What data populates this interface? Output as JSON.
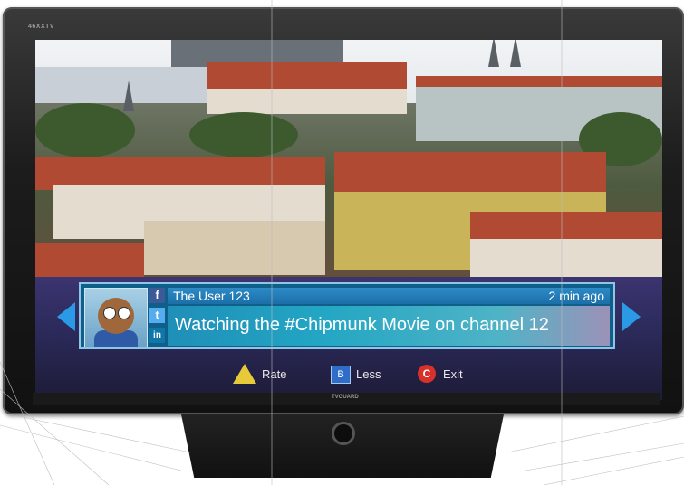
{
  "tv": {
    "brand_top": "46XXTV",
    "brand_bottom": "TVGUARD"
  },
  "post": {
    "user": "The User 123",
    "time_ago": "2 min ago",
    "message": "Watching the #Chipmunk Movie on channel 12"
  },
  "social_icons": [
    "facebook-icon",
    "twitter-icon",
    "linkedin-icon"
  ],
  "controls": {
    "rate_label": "Rate",
    "less_label": "Less",
    "exit_label": "Exit"
  },
  "colors": {
    "accent": "#2a9ae6",
    "rate": "#e7c93a",
    "less": "#2f6ec8",
    "exit": "#d8302a"
  }
}
